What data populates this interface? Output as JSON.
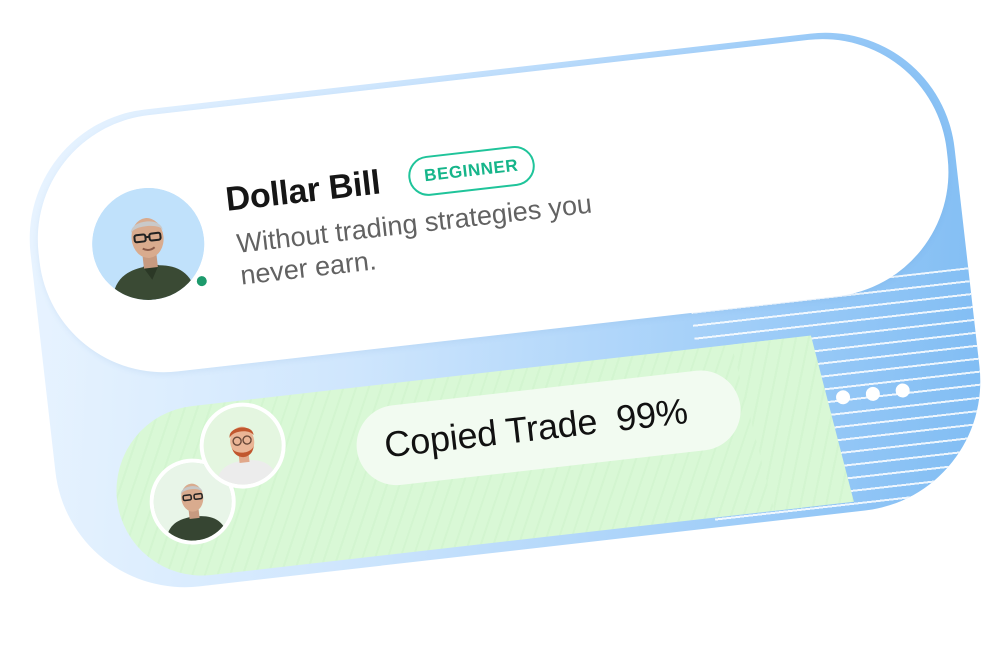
{
  "profile": {
    "name": "Dollar Bill",
    "level_badge": "BEGINNER",
    "bio": "Without trading strategies you never earn.",
    "status": "online",
    "avatar_icon": "person-avatar-icon"
  },
  "activity": {
    "label": "Copied Trade",
    "value": "99%"
  },
  "colors": {
    "badge_accent": "#1fc49a",
    "online": "#1d9a6c",
    "card_gradient_start": "#e9f4ff",
    "card_gradient_end": "#7fbcf3",
    "activity_background": "#d9f8d6"
  },
  "menu": {
    "icon": "more-dots-icon"
  }
}
